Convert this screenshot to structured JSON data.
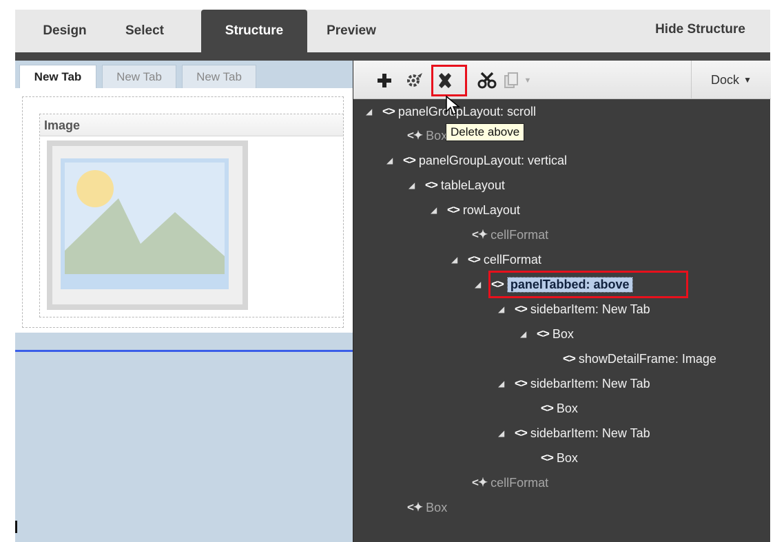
{
  "top_tabs": [
    "Design",
    "Select",
    "Structure",
    "Preview"
  ],
  "active_top_tab": "Structure",
  "hide_structure_label": "Hide Structure",
  "left_tabs": [
    "New Tab",
    "New Tab",
    "New Tab"
  ],
  "image_frame_title": "Image",
  "toolbar": {
    "icons": [
      "add-icon",
      "gear-icon",
      "delete-icon",
      "cut-icon",
      "copy-icon"
    ],
    "dock_label": "Dock",
    "tooltip": "Delete above"
  },
  "tree": [
    {
      "label": "panelGroupLayout: scroll"
    },
    {
      "label": "Box"
    },
    {
      "label": "panelGroupLayout: vertical"
    },
    {
      "label": "tableLayout"
    },
    {
      "label": "rowLayout"
    },
    {
      "label": "cellFormat"
    },
    {
      "label": "cellFormat"
    },
    {
      "label": "panelTabbed: above"
    },
    {
      "label": "sidebarItem: New Tab"
    },
    {
      "label": "Box"
    },
    {
      "label": "showDetailFrame: Image"
    },
    {
      "label": "sidebarItem: New Tab"
    },
    {
      "label": "Box"
    },
    {
      "label": "sidebarItem: New Tab"
    },
    {
      "label": "Box"
    },
    {
      "label": "cellFormat"
    },
    {
      "label": "Box"
    }
  ],
  "colors": {
    "pane_dark": "#3d3d3d",
    "canvas_blue": "#c6d6e4",
    "highlight_red": "#e8101c",
    "selection": "#b9cde8"
  }
}
